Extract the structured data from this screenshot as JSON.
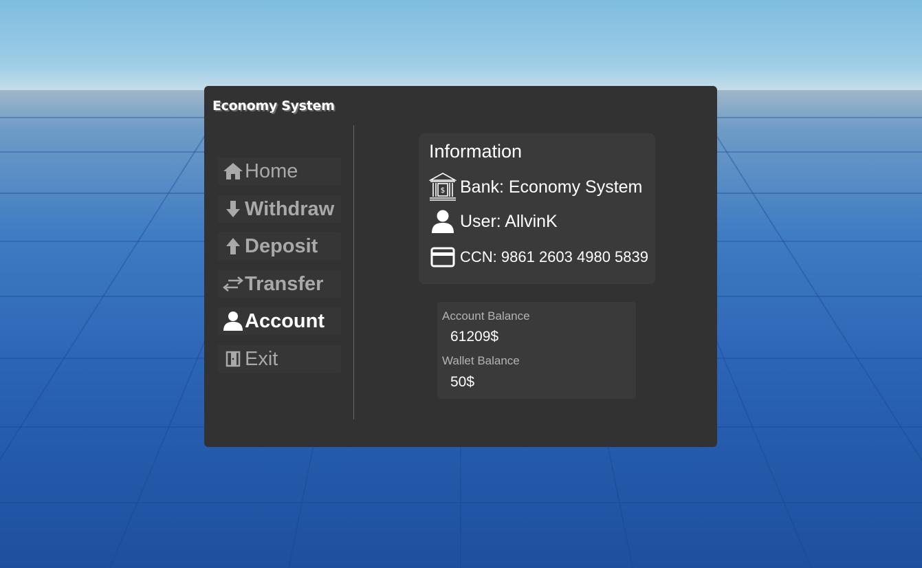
{
  "window": {
    "title": "Economy System"
  },
  "nav": {
    "items": [
      {
        "label": "Home",
        "icon": "home-icon",
        "state": "inactive"
      },
      {
        "label": "Withdraw",
        "icon": "arrow-down-icon",
        "state": "inactive"
      },
      {
        "label": "Deposit",
        "icon": "arrow-up-icon",
        "state": "inactive"
      },
      {
        "label": "Transfer",
        "icon": "transfer-arrows-icon",
        "state": "inactive"
      },
      {
        "label": "Account",
        "icon": "user-icon",
        "state": "active"
      },
      {
        "label": "Exit",
        "icon": "exit-door-icon",
        "state": "inactive"
      }
    ]
  },
  "information": {
    "heading": "Information",
    "bank": {
      "text": "Bank: Economy System",
      "icon": "bank-icon"
    },
    "user": {
      "text": "User: AllvinK",
      "icon": "user-icon"
    },
    "ccn": {
      "text": "CCN: 9861 2603 4980 5839",
      "icon": "credit-card-icon"
    }
  },
  "balances": {
    "account_label": "Account Balance",
    "account_value": "61209$",
    "wallet_label": "Wallet Balance",
    "wallet_value": "50$"
  },
  "colors": {
    "panel": "#323232",
    "card": "#3a3a3a",
    "active_text": "#ffffff",
    "inactive_text": "#a9a9a9"
  }
}
